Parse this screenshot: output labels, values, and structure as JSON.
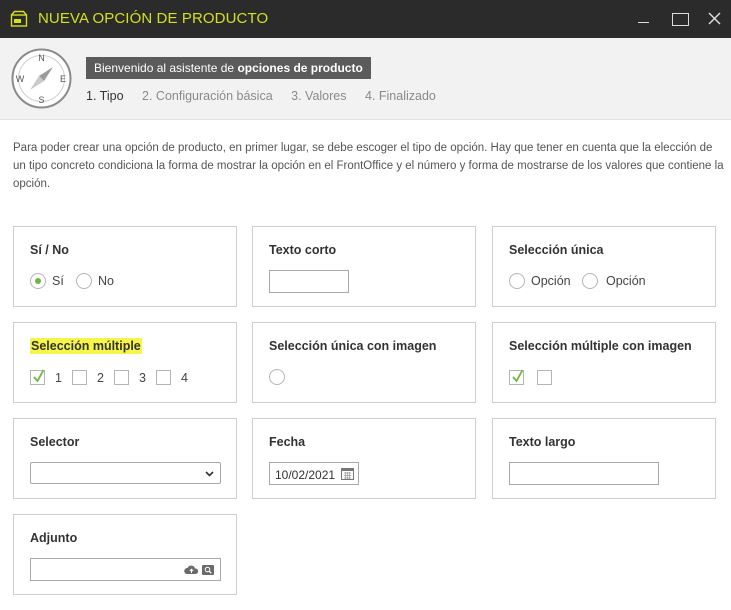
{
  "window": {
    "title": "NUEVA OPCIÓN DE PRODUCTO",
    "icons": {
      "app": "product-box-icon",
      "minimize": "minimize-icon",
      "maximize": "maximize-icon",
      "close": "close-icon"
    }
  },
  "wizard": {
    "welcome_prefix": "Bienvenido al asistente de ",
    "welcome_bold": "opciones de producto",
    "compass": {
      "n": "N",
      "e": "E",
      "s": "S",
      "w": "W"
    },
    "steps": [
      "1. Tipo",
      "2. Configuración básica",
      "3. Valores",
      "4. Finalizado"
    ],
    "active_step": 0
  },
  "description": "Para poder crear una opción de producto, en primer lugar, se debe escoger el tipo de opción. Hay que tener en cuenta que la elección de un tipo concreto condiciona la forma de mostrar la opción en el FrontOffice y el número y forma de mostrarse de los valores que contiene la opción.",
  "options": {
    "si_no": {
      "title": "Sí / No",
      "labels": [
        "Sí",
        "No"
      ],
      "selected": "Sí"
    },
    "texto_corto": {
      "title": "Texto corto",
      "value": ""
    },
    "seleccion_unica": {
      "title": "Selección única",
      "labels": [
        "Opción",
        "Opción"
      ]
    },
    "seleccion_multiple": {
      "title": "Selección múltiple",
      "labels": [
        "1",
        "2",
        "3",
        "4"
      ],
      "checked": [
        "1"
      ],
      "highlighted": true
    },
    "seleccion_unica_imagen": {
      "title": "Selección única con imagen"
    },
    "seleccion_multiple_imagen": {
      "title": "Selección múltiple con imagen",
      "checked": [
        true,
        false
      ]
    },
    "selector": {
      "title": "Selector",
      "value": ""
    },
    "fecha": {
      "title": "Fecha",
      "value": "10/02/2021"
    },
    "texto_largo": {
      "title": "Texto largo",
      "value": ""
    },
    "adjunto": {
      "title": "Adjunto",
      "value": ""
    }
  },
  "colors": {
    "titlebar": "#2b2b2b",
    "title_accent": "#d2e01e",
    "check_green": "#6fb640",
    "highlight": "#f6f64a"
  }
}
